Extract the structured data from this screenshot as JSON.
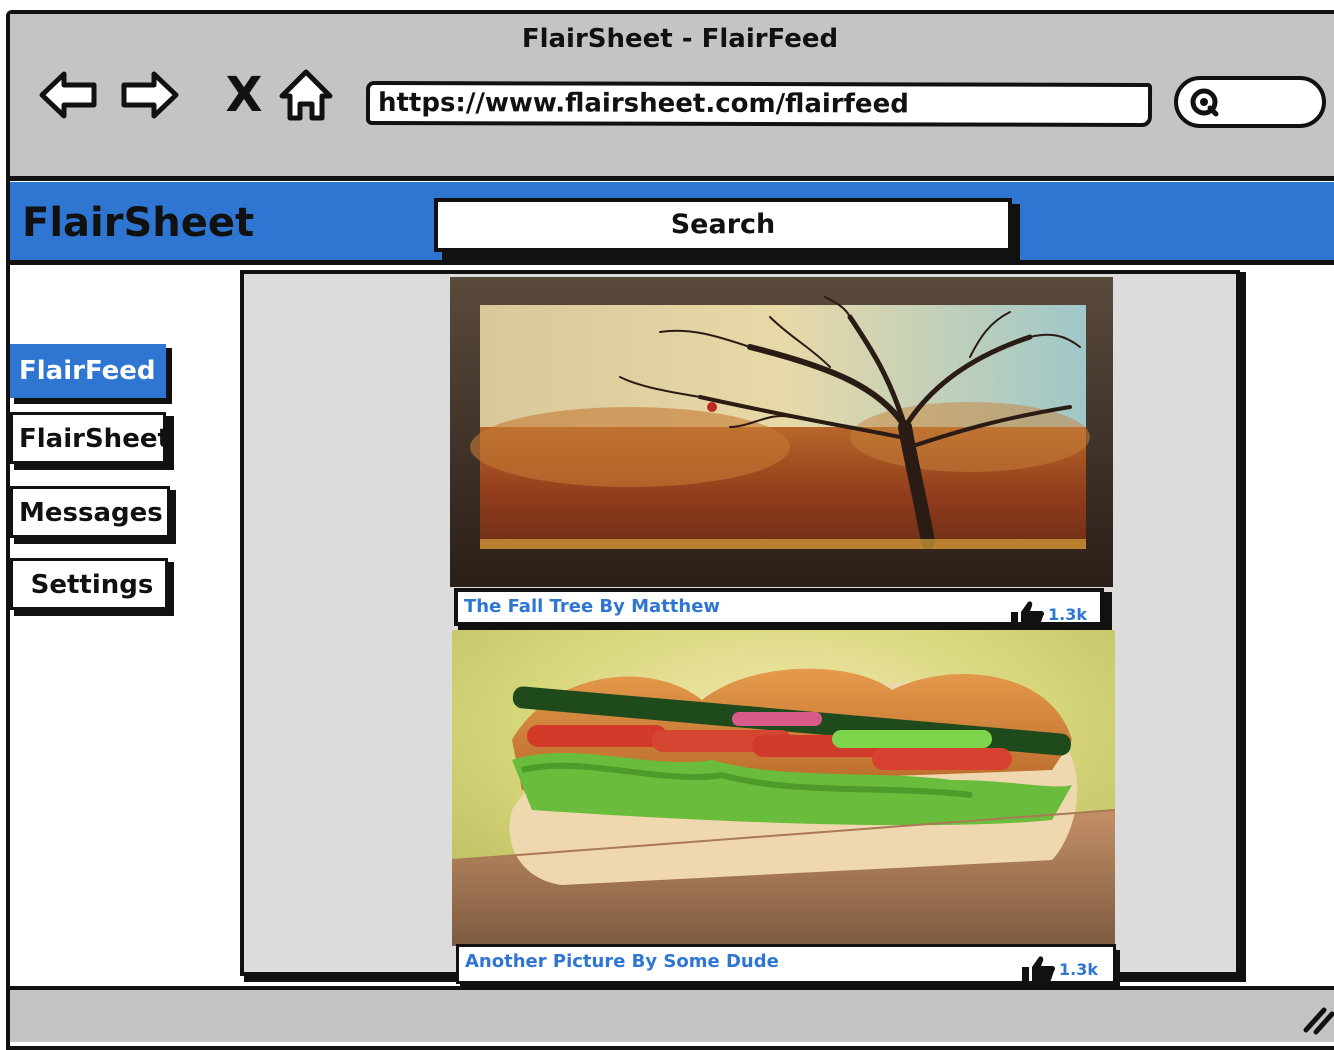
{
  "window": {
    "title": "FlairSheet - FlairFeed"
  },
  "browser": {
    "url": "https://www.flairsheet.com/flairfeed",
    "stop_glyph": "X"
  },
  "app": {
    "logo": "FlairSheet",
    "search_label": "Search",
    "accent_color": "#2f76d2"
  },
  "sidebar": {
    "items": [
      {
        "label": "FlairFeed",
        "active": true
      },
      {
        "label": "FlairSheet",
        "active": false
      },
      {
        "label": "Messages",
        "active": false
      },
      {
        "label": "Settings",
        "active": false
      }
    ]
  },
  "feed": {
    "posts": [
      {
        "title": "The Fall Tree By Matthew",
        "likes": "1.3k",
        "image": "autumn-tree-painting"
      },
      {
        "title": "Another Picture By Some Dude",
        "likes": "1.3k",
        "image": "sub-sandwich-photo"
      }
    ]
  }
}
